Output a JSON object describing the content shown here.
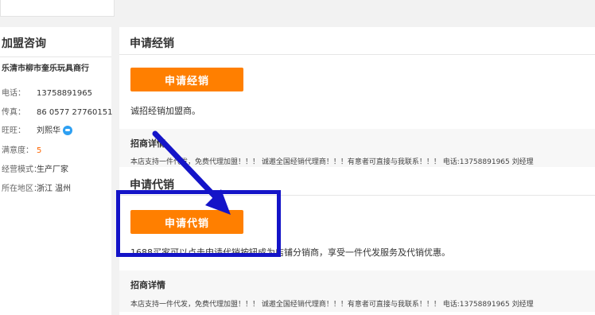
{
  "left_panel": {
    "title": "加盟咨询",
    "company": "乐清市柳市奎乐玩具商行",
    "rows": [
      {
        "key": "电话：",
        "value": "13758891965"
      },
      {
        "key": "传真：",
        "value": "86 0577 27760151"
      },
      {
        "key": "旺旺：",
        "value": "刘熙华"
      },
      {
        "key": "满意度：",
        "value": "5"
      },
      {
        "key": "经营模式：",
        "value": "生产厂家"
      },
      {
        "key": "所在地区：",
        "value": "浙江 温州"
      }
    ]
  },
  "distribution": {
    "title": "申请经销",
    "button_label": "申请经销",
    "description": "诚招经销加盟商。",
    "invite_title": "招商详情",
    "invite_text": "本店支持一件代发，免费代理加盟！！！ 诚邀全国经销代理商！！！有意者可直接与我联系！！！ 电话:13758891965 刘经理"
  },
  "agency": {
    "title": "申请代销",
    "button_label": "申请代销",
    "description": "1688买家可以点击申请代销按钮成为店铺分销商，享受一件代发服务及代销优惠。",
    "invite_title": "招商详情",
    "invite_text": "本店支持一件代发，免费代理加盟！！！ 诚邀全国经销代理商！！！有意者可直接与我联系！！！ 电话:13758891965 刘经理"
  },
  "colors": {
    "button": "#ff7f00",
    "annotation": "#1414c8",
    "accent_orange": "#ff6600"
  }
}
